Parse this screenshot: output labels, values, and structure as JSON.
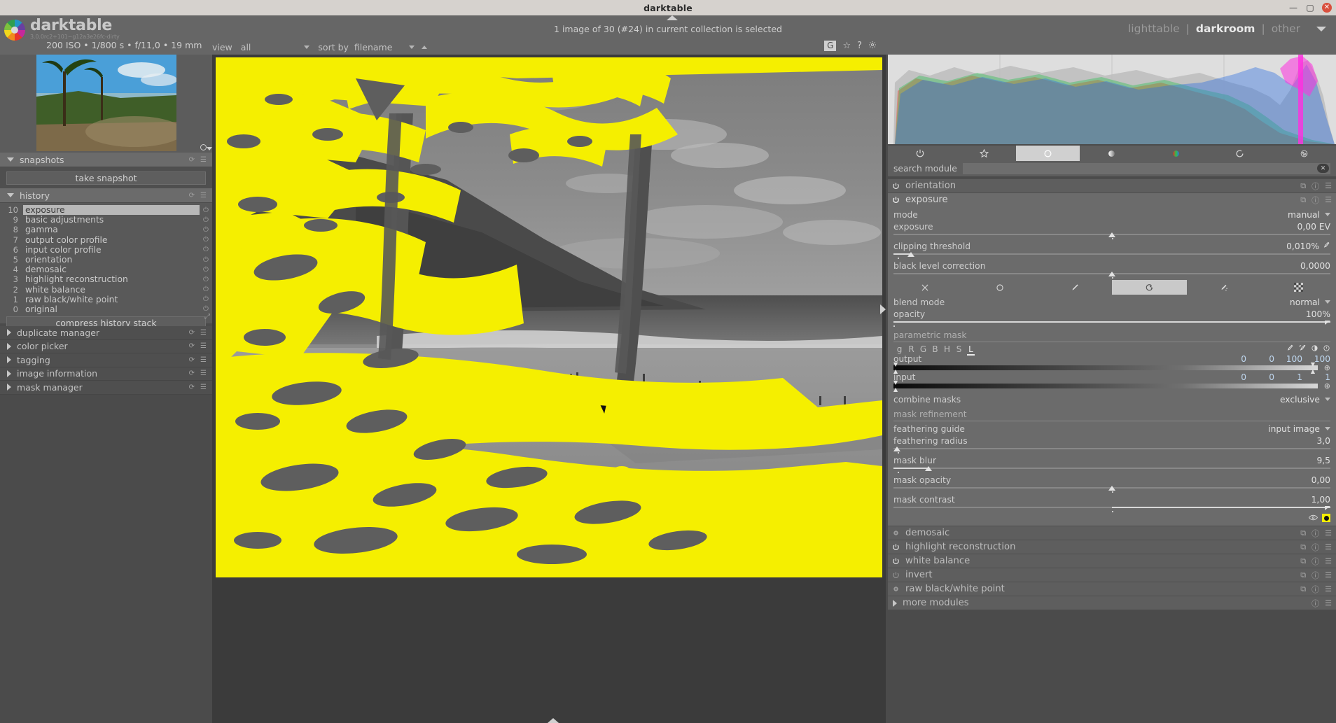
{
  "window": {
    "title": "darktable",
    "buttons": {
      "minimize": "—",
      "maximize": "▢",
      "close": "✕"
    }
  },
  "brand": {
    "name": "darktable",
    "version": "3.0.0rc2+101~g12a3e26fc-dirty"
  },
  "topbar": {
    "collection_status": "1 image of 30 (#24) in current collection is selected",
    "exif": "200 ISO • 1/800 s • f/11,0 • 19 mm",
    "filter": {
      "view_label": "view",
      "view_value": "all",
      "sort_label": "sort by",
      "sort_value": "filename"
    },
    "icons": {
      "grouping": "G",
      "overlays": "☆",
      "help": "?",
      "preferences": "gear-icon"
    },
    "views": {
      "lighttable": "lighttable",
      "darkroom": "darkroom",
      "other": "other",
      "separator": "|"
    }
  },
  "left_panel": {
    "snapshots": {
      "title": "snapshots",
      "take_snapshot": "take snapshot"
    },
    "history": {
      "title": "history",
      "compress": "compress history stack",
      "items": [
        {
          "num": "10",
          "label": "exposure",
          "selected": true
        },
        {
          "num": "9",
          "label": "basic adjustments",
          "selected": false
        },
        {
          "num": "8",
          "label": "gamma",
          "selected": false
        },
        {
          "num": "7",
          "label": "output color profile",
          "selected": false
        },
        {
          "num": "6",
          "label": "input color profile",
          "selected": false
        },
        {
          "num": "5",
          "label": "orientation",
          "selected": false
        },
        {
          "num": "4",
          "label": "demosaic",
          "selected": false
        },
        {
          "num": "3",
          "label": "highlight reconstruction",
          "selected": false
        },
        {
          "num": "2",
          "label": "white balance",
          "selected": false
        },
        {
          "num": "1",
          "label": "raw black/white point",
          "selected": false
        },
        {
          "num": "0",
          "label": "original",
          "selected": false
        }
      ]
    },
    "modules": [
      {
        "label": "duplicate manager"
      },
      {
        "label": "color picker"
      },
      {
        "label": "tagging"
      },
      {
        "label": "image information"
      },
      {
        "label": "mask manager"
      }
    ]
  },
  "right_panel": {
    "group_icons": [
      {
        "name": "power-icon",
        "active": false
      },
      {
        "name": "favorites-icon",
        "active": false
      },
      {
        "name": "technical-icon",
        "active": true
      },
      {
        "name": "tone-icon",
        "active": false
      },
      {
        "name": "color-icon",
        "active": false
      },
      {
        "name": "correction-icon",
        "active": false
      },
      {
        "name": "effects-icon",
        "active": false
      }
    ],
    "search": {
      "label": "search module",
      "value": "",
      "placeholder": ""
    },
    "modules_above": [
      {
        "label": "orientation",
        "enabled": true
      }
    ],
    "exposure": {
      "label": "exposure",
      "enabled": true,
      "mode": {
        "label": "mode",
        "value": "manual"
      },
      "exposure": {
        "label": "exposure",
        "value": "0,00 EV",
        "pos": 50
      },
      "clipping_threshold": {
        "label": "clipping threshold",
        "value": "0,010%",
        "pos": 5
      },
      "black_level_correction": {
        "label": "black level correction",
        "value": "0,0000",
        "pos": 50
      }
    },
    "blend": {
      "tabs": [
        {
          "name": "blend-off-icon",
          "active": false
        },
        {
          "name": "blend-uniformly-icon",
          "active": false
        },
        {
          "name": "blend-drawn-mask-icon",
          "active": false
        },
        {
          "name": "blend-parametric-mask-icon",
          "active": true
        },
        {
          "name": "blend-drawn-parametric-icon",
          "active": false
        },
        {
          "name": "blend-raster-mask-icon",
          "active": false
        }
      ],
      "blend_mode": {
        "label": "blend mode",
        "value": "normal"
      },
      "opacity": {
        "label": "opacity",
        "value": "100%",
        "pos": 100
      },
      "parametric_mask": {
        "title": "parametric mask",
        "channels": [
          "g",
          "R",
          "G",
          "B",
          "H",
          "S",
          "L"
        ],
        "selected_channel": "L",
        "icons": [
          "picker-icon",
          "picker-area-icon",
          "invert-icon",
          "reset-icon"
        ],
        "output": {
          "label": "output",
          "values": [
            "0",
            "0",
            "100",
            "100"
          ]
        },
        "input": {
          "label": "input",
          "values": [
            "0",
            "0",
            "1",
            "1"
          ]
        }
      },
      "combine_masks": {
        "label": "combine masks",
        "value": "exclusive"
      },
      "mask_refinement": {
        "title": "mask refinement",
        "feathering_guide": {
          "label": "feathering guide",
          "value": "input image"
        },
        "feathering_radius": {
          "label": "feathering radius",
          "value": "3,0",
          "pos": 2
        },
        "mask_blur": {
          "label": "mask blur",
          "value": "9,5",
          "pos": 9
        },
        "mask_opacity": {
          "label": "mask opacity",
          "value": "0,00",
          "pos": 50
        },
        "mask_contrast": {
          "label": "mask contrast",
          "value": "1,00",
          "pos": 50
        }
      },
      "mask_display": {
        "eye": "display-mask-icon",
        "indicator": "yellow-mask-on"
      }
    },
    "modules_below": [
      {
        "label": "demosaic",
        "enabled": "dim"
      },
      {
        "label": "highlight reconstruction",
        "enabled": "on"
      },
      {
        "label": "white balance",
        "enabled": "on"
      },
      {
        "label": "invert",
        "enabled": "off"
      },
      {
        "label": "raw black/white point",
        "enabled": "dim"
      },
      {
        "label": "more modules",
        "enabled": "none"
      }
    ]
  },
  "colors": {
    "mask_overlay": "#F5EF00",
    "panel_bg": "#4b4b4b",
    "module_bg": "#6b6b6b",
    "header_bg": "#5e5e5e",
    "titlebar_bg": "#d6d2ce",
    "accent_text": "#cfcfcf"
  }
}
